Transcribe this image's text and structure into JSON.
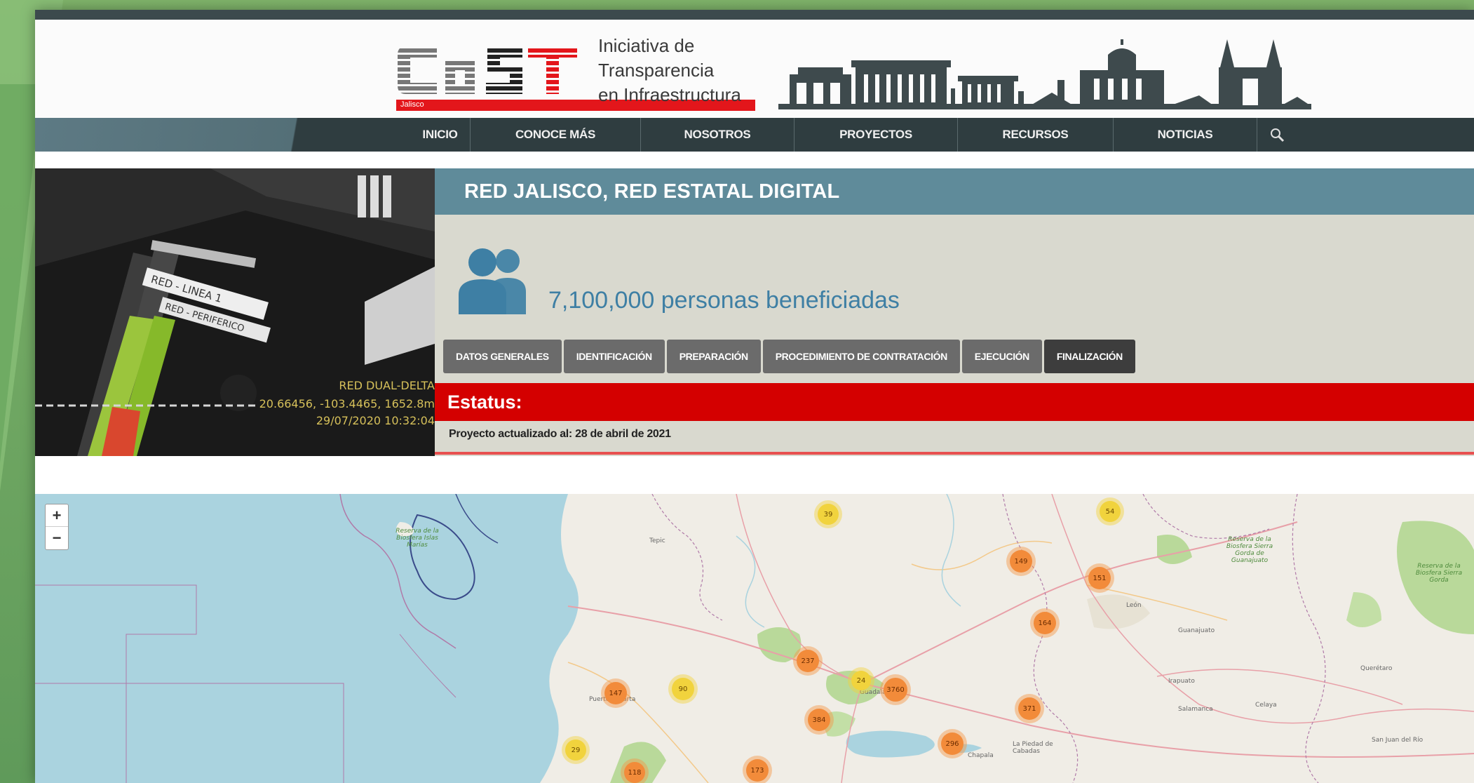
{
  "logo": {
    "mark_text": "CoST",
    "badge": "Jalisco",
    "lines": [
      "Iniciativa de",
      "Transparencia",
      "en Infraestructura"
    ]
  },
  "nav": {
    "items": [
      "INICIO",
      "CONOCE MÁS",
      "NOSOTROS",
      "PROYECTOS",
      "RECURSOS",
      "NOTICIAS"
    ],
    "search_icon": "search-icon"
  },
  "photo": {
    "label_1": "RED - LINEA 1",
    "label_2": "RED - PERIFERICO",
    "caption_1": "RED DUAL-DELTA",
    "caption_2": "20.66456, -103.4465, 1652.8m",
    "caption_3": "29/07/2020 10:32:04"
  },
  "project": {
    "title": "RED JALISCO, RED ESTATAL DIGITAL",
    "beneficiaries": "7,100,000 personas beneficiadas",
    "tabs": [
      "DATOS GENERALES",
      "IDENTIFICACIÓN",
      "PREPARACIÓN",
      "PROCEDIMIENTO DE CONTRATACIÓN",
      "EJECUCIÓN",
      "FINALIZACIÓN"
    ],
    "status_label": "Estatus:",
    "updated": "Proyecto actualizado al: 28 de abril de 2021"
  },
  "map": {
    "zoom_in": "+",
    "zoom_out": "−",
    "clusters": [
      "39",
      "54",
      "149",
      "151",
      "164",
      "237",
      "24",
      "3760",
      "90",
      "147",
      "371",
      "384",
      "296",
      "29",
      "118",
      "173"
    ],
    "labels": [
      "Reserva de la Biosfera Islas Marías",
      "León",
      "Guanajuato",
      "Querétaro",
      "Salamanca",
      "Celaya",
      "Irapuato",
      "Reserva de la Biosfera Sierra Gorda de Guanajuato",
      "Reserva de la Biosfera Sierra Gorda",
      "Guadalajara",
      "Puerto Vallarta",
      "Tepic",
      "La Piedad de Cabadas",
      "San Juan del Río",
      "Chapala"
    ]
  },
  "colors": {
    "header_title_bg": "#5f8b9a",
    "panel_bg": "#d9d9cf",
    "status_red": "#d40000",
    "nav_bg": "#2f3d40",
    "beneficiaries_blue": "#3e7fa4"
  }
}
